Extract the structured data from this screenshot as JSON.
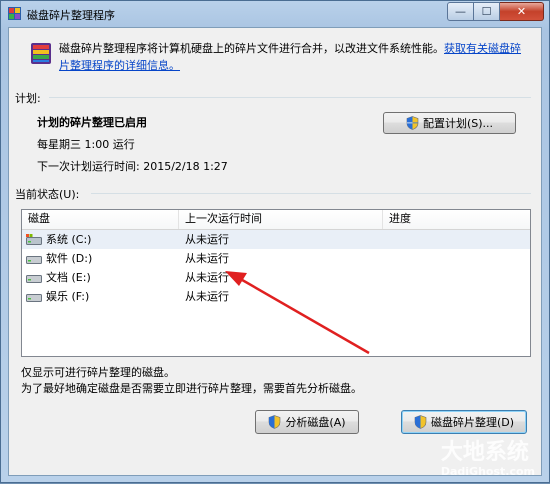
{
  "window": {
    "title": "磁盘碎片整理程序",
    "close_label": "✕",
    "min_label": "—",
    "max_label": "☐"
  },
  "intro": {
    "text": "磁盘碎片整理程序将计算机硬盘上的碎片文件进行合并，以改进文件系统性能。",
    "link": "获取有关磁盘碎片整理程序的详细信息。"
  },
  "schedule": {
    "section_label": "计划:",
    "status": "计划的碎片整理已启用",
    "frequency": "每星期三 1:00 运行",
    "next_run": "下一次计划运行时间: 2015/2/18 1:27",
    "configure_button": "配置计划(S)..."
  },
  "current_status": {
    "section_label": "当前状态(U):",
    "columns": [
      "磁盘",
      "上一次运行时间",
      "进度"
    ],
    "disks": [
      {
        "name": "系统 (C:)",
        "last_run": "从未运行",
        "progress": "",
        "icon": "system-drive-icon"
      },
      {
        "name": "软件 (D:)",
        "last_run": "从未运行",
        "progress": "",
        "icon": "drive-icon"
      },
      {
        "name": "文档 (E:)",
        "last_run": "从未运行",
        "progress": "",
        "icon": "drive-icon"
      },
      {
        "name": "娱乐 (F:)",
        "last_run": "从未运行",
        "progress": "",
        "icon": "drive-icon"
      }
    ]
  },
  "footer": {
    "note1": "仅显示可进行碎片整理的磁盘。",
    "note2": "为了最好地确定磁盘是否需要立即进行碎片整理，需要首先分析磁盘。",
    "analyze_button": "分析磁盘(A)",
    "defrag_button": "磁盘碎片整理(D)"
  },
  "watermark": {
    "line1": "大地系统",
    "line2": "DadiGhost.com"
  },
  "colors": {
    "annotation_arrow": "#e02020",
    "link": "#0645c8"
  }
}
